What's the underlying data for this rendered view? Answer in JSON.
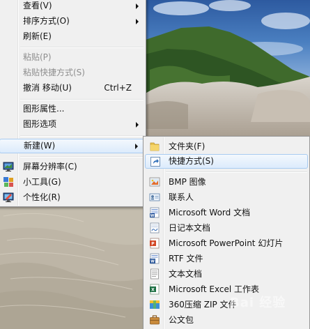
{
  "context_menu": {
    "items": [
      {
        "label": "查看(V)"
      },
      {
        "label": "排序方式(O)"
      },
      {
        "label": "刷新(E)"
      },
      {
        "label": "粘贴(P)"
      },
      {
        "label": "粘贴快捷方式(S)"
      },
      {
        "label": "撤消 移动(U)",
        "shortcut": "Ctrl+Z"
      },
      {
        "label": "图形属性..."
      },
      {
        "label": "图形选项"
      },
      {
        "label": "新建(W)"
      },
      {
        "label": "屏幕分辨率(C)"
      },
      {
        "label": "小工具(G)"
      },
      {
        "label": "个性化(R)"
      }
    ]
  },
  "new_submenu": {
    "items": [
      {
        "label": "文件夹(F)"
      },
      {
        "label": "快捷方式(S)"
      },
      {
        "label": "BMP 图像"
      },
      {
        "label": "联系人"
      },
      {
        "label": "Microsoft Word 文档"
      },
      {
        "label": "日记本文档"
      },
      {
        "label": "Microsoft PowerPoint 幻灯片"
      },
      {
        "label": "RTF 文件"
      },
      {
        "label": "文本文档"
      },
      {
        "label": "Microsoft Excel 工作表"
      },
      {
        "label": "360压缩 ZIP 文件"
      },
      {
        "label": "公文包"
      }
    ]
  },
  "watermark": {
    "text": "Bai 经验"
  },
  "colors": {
    "menu_bg": "#f0f0f0",
    "highlight_border": "#a8cbf1",
    "highlight_bg": "#dcebfc",
    "disabled_text": "#8e8e8e"
  }
}
